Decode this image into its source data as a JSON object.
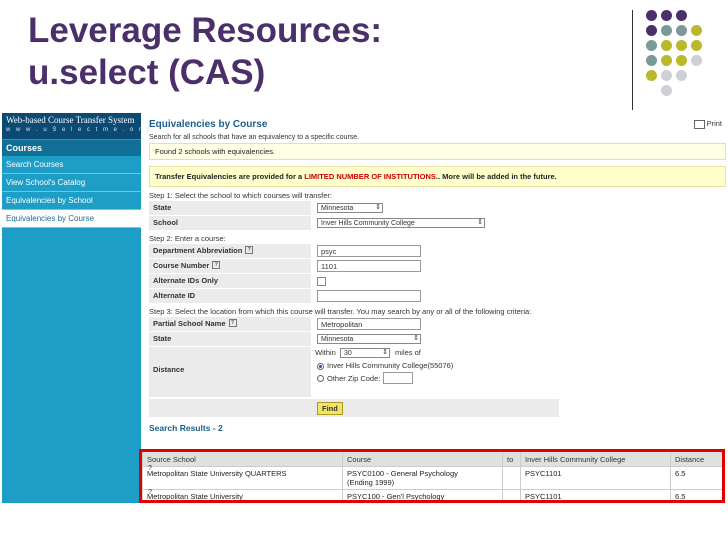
{
  "slide": {
    "title_line1": "Leverage Resources:",
    "title_line2": "u.select (CAS)",
    "colors": {
      "title": "#4b2f6b",
      "dot_purple": "#4b2f6b",
      "dot_teal": "#7a9a9a",
      "dot_olive": "#b9b92a",
      "dot_gray": "#cfcfd6",
      "highlight": "#e00000"
    }
  },
  "sidebar": {
    "logo_title": "Web-based Course Transfer System",
    "logo_sub": "w w w . u S e l e c t m e . o r g",
    "heading": "Courses",
    "items": [
      "Search Courses",
      "View School's Catalog",
      "Equivalencies by School",
      "Equivalencies by Course"
    ],
    "active_index": 3
  },
  "main": {
    "title": "Equivalencies by Course",
    "print_label": "Print",
    "description": "Search for all schools that have an equivalency to a specific course.",
    "found_message": "Found 2 schools with equivalencies.",
    "transfer_notice_pre": "Transfer Equivalencies are provided for a ",
    "transfer_notice_highlight": "LIMITED NUMBER OF INSTITUTIONS",
    "transfer_notice_post": ".. More will be added in the future.",
    "step1": {
      "label": "Step 1: Select the school to which courses will transfer:",
      "state_label": "State",
      "state_value": "Minnesota",
      "school_label": "School",
      "school_value": "Inver Hills Community College"
    },
    "step2": {
      "label": "Step 2: Enter a course:",
      "dept_label": "Department Abbreviation",
      "dept_value": "psyc",
      "course_number_label": "Course Number",
      "course_number_value": "1101",
      "alt_ids_only_label": "Alternate IDs Only",
      "alt_id_label": "Alternate ID",
      "alt_id_value": ""
    },
    "step3": {
      "label": "Step 3: Select the location from which this course will transfer. You may search by any or all of the following criteria:",
      "partial_school_label": "Partial School Name",
      "partial_school_value": "Metropolitan",
      "state_label": "State",
      "state_value": "Minnesota",
      "distance_label": "Distance",
      "within_label": "Within",
      "within_value": "30",
      "miles_label": "miles of",
      "radio_option1": "Inver Hills Community College(55076)",
      "radio_option2": "Other Zip Code:",
      "zip_value": ""
    },
    "find_button": "Find",
    "results_title": "Search Results - 2",
    "help_icon_glyph": "?",
    "results": {
      "columns": [
        "Source School",
        "Course",
        "to",
        "Inver Hills Community College",
        "Distance"
      ],
      "rows": [
        {
          "marker": "?",
          "school": "Metropolitan State University QUARTERS",
          "course": "PSYC0100 - General Psychology",
          "course_note": "(Ending 1999)",
          "to": "",
          "target": "PSYC1101",
          "distance": "6.5"
        },
        {
          "marker": "?",
          "school": "Metropolitan State University",
          "course": "PSYC100 - Gen'l Psychology",
          "course_note": "",
          "to": "",
          "target": "PSYC1101",
          "distance": "6.5"
        }
      ]
    }
  }
}
